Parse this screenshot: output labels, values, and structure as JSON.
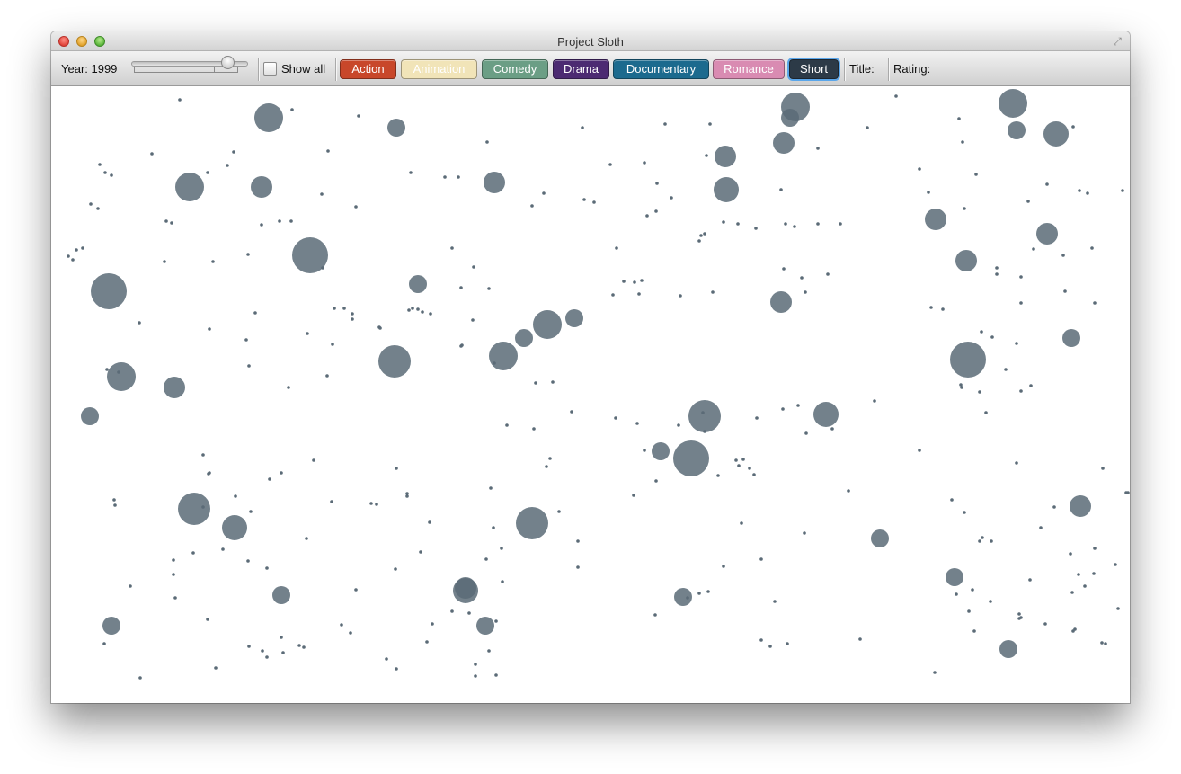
{
  "window": {
    "title": "Project Sloth",
    "controls": [
      "close",
      "minimize",
      "zoom"
    ],
    "fullscreen_icon": "fullscreen-arrows-icon"
  },
  "toolbar": {
    "year_label": "Year: 1999",
    "year_value": 1999,
    "show_all_label": "Show all",
    "show_all_checked": false,
    "title_label": "Title:",
    "rating_label": "Rating:",
    "genres": [
      {
        "label": "Action",
        "color": "#c8472a",
        "selected": false
      },
      {
        "label": "Animation",
        "color": "#f1e4b8",
        "text_color": "#ffffff",
        "selected": false
      },
      {
        "label": "Comedy",
        "color": "#6b9e85",
        "selected": false
      },
      {
        "label": "Drama",
        "color": "#4c2a72",
        "selected": false
      },
      {
        "label": "Documentary",
        "color": "#1c6a8e",
        "selected": false
      },
      {
        "label": "Romance",
        "color": "#d98bb2",
        "selected": false
      },
      {
        "label": "Short",
        "color": "#2c3a47",
        "selected": true
      }
    ]
  },
  "plot": {
    "dot_color": "#5b6b77"
  }
}
